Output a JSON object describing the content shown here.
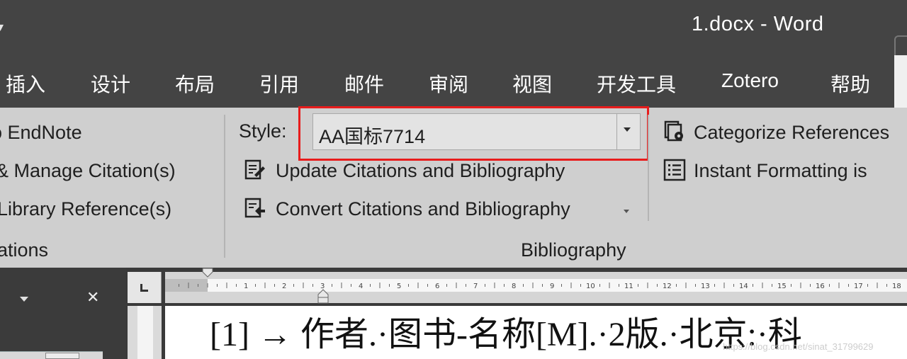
{
  "window": {
    "title": "1.docx  -  Word"
  },
  "tabs": [
    "插入",
    "设计",
    "布局",
    "引用",
    "邮件",
    "审阅",
    "视图",
    "开发工具",
    "Zotero",
    "帮助"
  ],
  "ribbon": {
    "endnote_group": {
      "items": [
        "o EndNote",
        "& Manage Citation(s)",
        "Library Reference(s)"
      ],
      "group_label": "ations"
    },
    "bibliography_group": {
      "style_label": "Style:",
      "style_value": "AA国标7714",
      "update_label": "Update Citations and Bibliography",
      "convert_label": "Convert Citations and Bibliography",
      "group_label": "Bibliography"
    },
    "tools_group": {
      "categorize_label": "Categorize References",
      "instant_label": "Instant Formatting is"
    }
  },
  "document": {
    "line_text": "[1] → 作者.·图书-名称[M].·2版.·北京:·科"
  },
  "watermark": "https://blog.csdn.net/sinat_31799629",
  "colors": {
    "highlight": "#e81c1c",
    "titlebar": "#444444",
    "ribbon": "#cfcfcf"
  }
}
